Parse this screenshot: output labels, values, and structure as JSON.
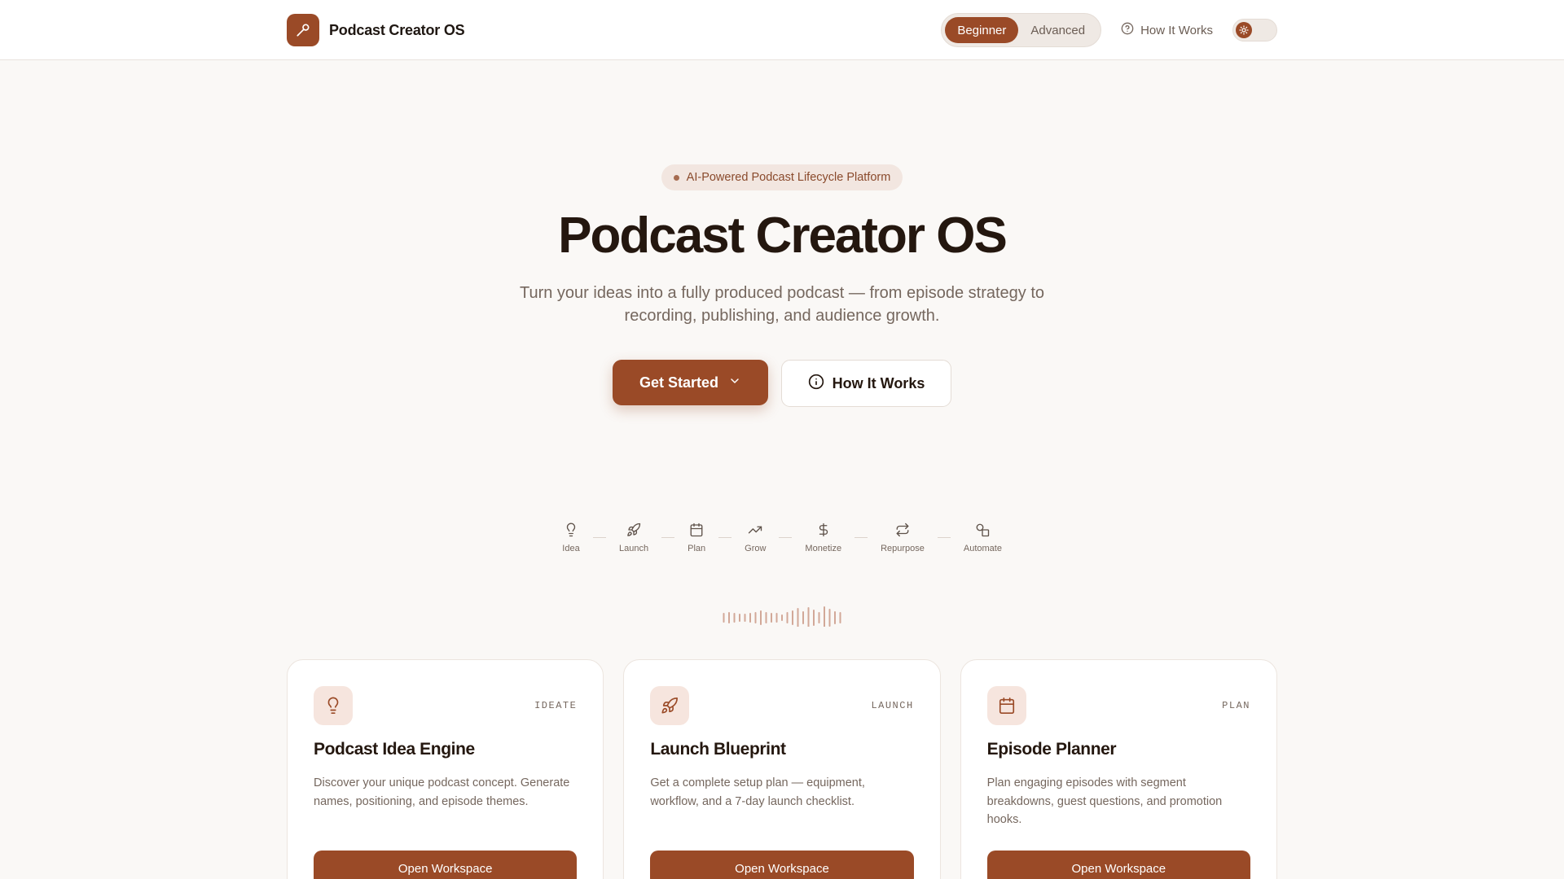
{
  "header": {
    "brand_name": "Podcast Creator OS",
    "modes": [
      "Beginner",
      "Advanced"
    ],
    "active_mode": "Beginner",
    "how_it_works": "How It Works"
  },
  "hero": {
    "badge": "AI-Powered Podcast Lifecycle Platform",
    "title": "Podcast Creator OS",
    "subtitle": "Turn your ideas into a fully produced podcast — from episode strategy to recording, publishing, and audience growth.",
    "primary_cta": "Get Started",
    "secondary_cta": "How It Works"
  },
  "steps": [
    {
      "label": "Idea",
      "icon": "lightbulb-icon"
    },
    {
      "label": "Launch",
      "icon": "rocket-icon"
    },
    {
      "label": "Plan",
      "icon": "calendar-icon"
    },
    {
      "label": "Grow",
      "icon": "trending-up-icon"
    },
    {
      "label": "Monetize",
      "icon": "dollar-icon"
    },
    {
      "label": "Repurpose",
      "icon": "repeat-icon"
    },
    {
      "label": "Automate",
      "icon": "shapes-icon"
    }
  ],
  "cards": [
    {
      "tag": "IDEATE",
      "title": "Podcast Idea Engine",
      "description": "Discover your unique podcast concept. Generate names, positioning, and episode themes.",
      "button": "Open Workspace",
      "icon": "lightbulb-icon"
    },
    {
      "tag": "LAUNCH",
      "title": "Launch Blueprint",
      "description": "Get a complete setup plan — equipment, workflow, and a 7-day launch checklist.",
      "button": "Open Workspace",
      "icon": "rocket-icon"
    },
    {
      "tag": "PLAN",
      "title": "Episode Planner",
      "description": "Plan engaging episodes with segment breakdowns, guest questions, and promotion hooks.",
      "button": "Open Workspace",
      "icon": "calendar-icon"
    }
  ],
  "colors": {
    "accent": "#9a4a27",
    "background": "#faf8f6",
    "pill_bg": "#f2e6e0",
    "text_muted": "#75675e"
  }
}
